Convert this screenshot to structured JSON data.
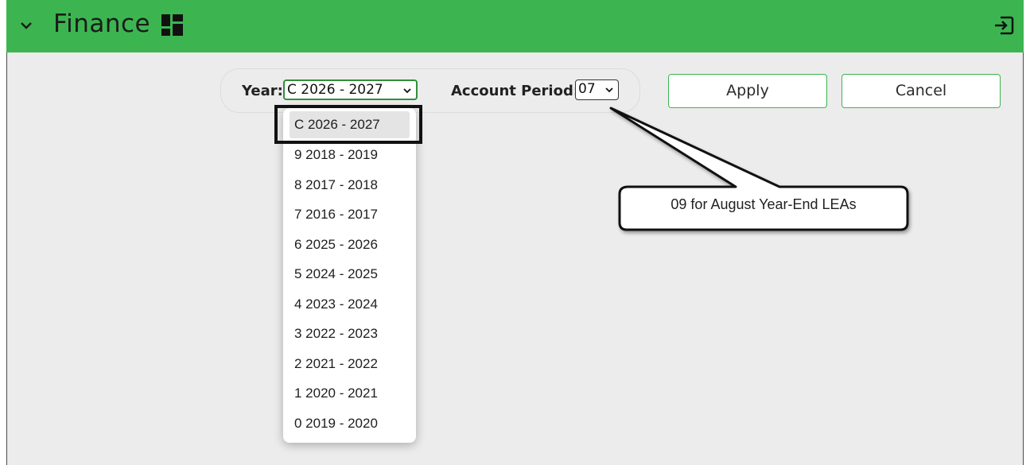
{
  "app": {
    "title": "Finance"
  },
  "filters": {
    "year_label": "Year:",
    "year_value": "C 2026 - 2027",
    "period_label": "Account Period:",
    "period_value": "07"
  },
  "buttons": {
    "apply": "Apply",
    "cancel": "Cancel"
  },
  "year_options": [
    "C 2026 - 2027",
    "9 2018 - 2019",
    "8 2017 - 2018",
    "7 2016 - 2017",
    "6 2025 - 2026",
    "5 2024 - 2025",
    "4 2023 - 2024",
    "3 2022 - 2023",
    "2 2021 - 2022",
    "1 2020 - 2021",
    "0 2019 - 2020"
  ],
  "callout": {
    "text": "09 for August Year-End LEAs"
  },
  "icons": {
    "collapse": "chevron-down-icon",
    "dashboard": "grid-layout-icon",
    "exit": "exit-icon"
  },
  "colors": {
    "header": "#3cb550",
    "accent_border": "#2f8f3c",
    "background": "#ececec"
  }
}
